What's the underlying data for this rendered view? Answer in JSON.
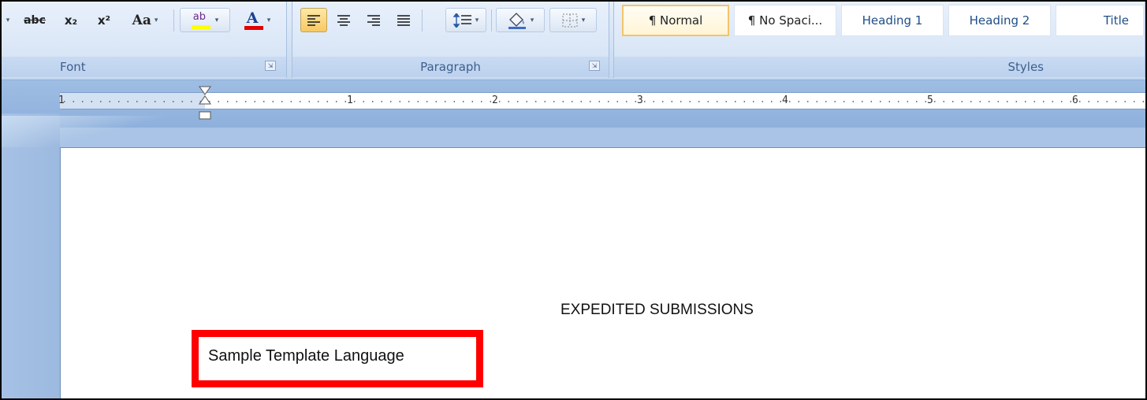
{
  "ribbon": {
    "font_group": {
      "label": "Font",
      "buttons": {
        "strikethrough": "abc",
        "subscript": "x₂",
        "superscript": "x²",
        "change_case": "Aa",
        "highlight": "ab",
        "font_color": "A"
      }
    },
    "paragraph_group": {
      "label": "Paragraph"
    },
    "styles_group": {
      "label": "Styles",
      "items": [
        {
          "label": "¶ Normal",
          "selected": true
        },
        {
          "label": "¶ No Spaci...",
          "selected": false
        },
        {
          "label": "Heading 1",
          "selected": false
        },
        {
          "label": "Heading 2",
          "selected": false
        },
        {
          "label": "Title",
          "selected": false
        }
      ]
    }
  },
  "ruler": {
    "numbers": [
      "1",
      "1",
      "2",
      "3",
      "4",
      "5",
      "6"
    ]
  },
  "document": {
    "heading": "EXPEDITED SUBMISSIONS",
    "highlighted_line": "Sample Template Language"
  },
  "colors": {
    "highlight_box": "#ff0000",
    "highlight_yellow": "#ffff00",
    "font_color_red": "#e00000",
    "selected_style_border": "#f2c56a"
  },
  "icons": [
    "dropdown-arrow-icon",
    "strikethrough-icon",
    "subscript-icon",
    "superscript-icon",
    "change-case-icon",
    "highlighter-icon",
    "font-color-icon",
    "dialog-launcher-icon",
    "align-left-icon",
    "align-center-icon",
    "align-right-icon",
    "justify-icon",
    "line-spacing-icon",
    "shading-icon",
    "borders-icon",
    "indent-marker-icon"
  ]
}
